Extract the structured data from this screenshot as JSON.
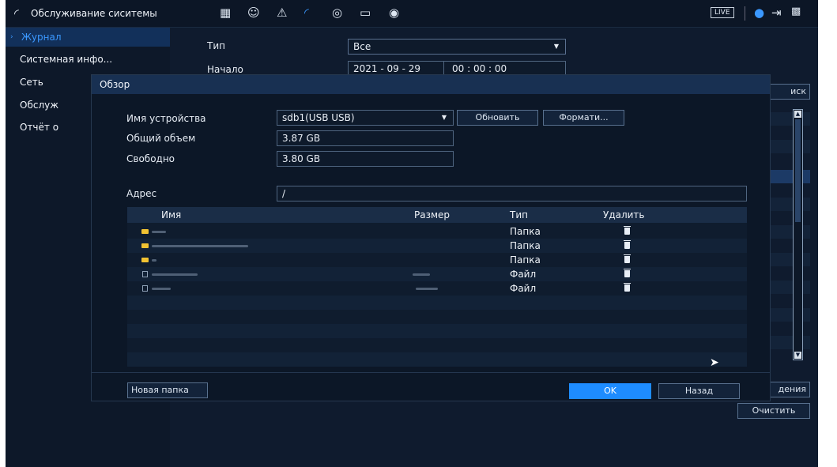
{
  "topbar": {
    "title": "Обслуживание сиситемы",
    "icons": [
      "analytics-icon",
      "face-icon",
      "alarm-icon",
      "maintenance-icon",
      "record-icon",
      "display-icon",
      "audio-icon"
    ],
    "live_label": "LIVE"
  },
  "sidebar": {
    "items": [
      {
        "label": "Журнал",
        "active": true
      },
      {
        "label": "Системная инфо...",
        "active": false
      },
      {
        "label": "Сеть",
        "active": false
      },
      {
        "label": "Обслуж",
        "active": false
      },
      {
        "label": "Отчёт о",
        "active": false
      }
    ]
  },
  "filter": {
    "type_label": "Тип",
    "type_value": "Все",
    "start_label": "Начало",
    "start_date": "2021 - 09 - 29",
    "start_time": "00 : 00 : 00",
    "search_label": "иск"
  },
  "modal": {
    "title": "Обзор",
    "device_label": "Имя устройства",
    "device_value": "sdb1(USB USB)",
    "refresh_label": "Обновить",
    "format_label": "Формати...",
    "total_label": "Общий объем",
    "total_value": "3.87 GB",
    "free_label": "Свободно",
    "free_value": "3.80 GB",
    "address_label": "Адрес",
    "address_value": "/",
    "columns": {
      "name": "Имя",
      "size": "Размер",
      "type": "Тип",
      "delete": "Удалить"
    },
    "rows": [
      {
        "type": "Папка",
        "icon": "folder-icon"
      },
      {
        "type": "Папка",
        "icon": "folder-icon"
      },
      {
        "type": "Папка",
        "icon": "folder-icon"
      },
      {
        "type": "Файл",
        "icon": "file-icon"
      },
      {
        "type": "Файл",
        "icon": "file-icon"
      }
    ],
    "new_folder_label": "Новая папка",
    "ok_label": "OK",
    "back_label": "Назад"
  },
  "bottom": {
    "partial_label": "дения",
    "clear_label": "Очистить"
  },
  "colors": {
    "background": "#0f1b2e",
    "accent": "#1e8cff",
    "active_text": "#3b98ff"
  }
}
